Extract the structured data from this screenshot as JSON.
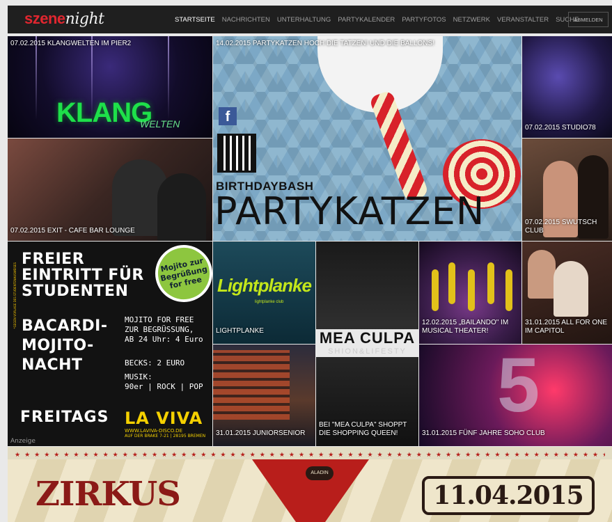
{
  "logo": {
    "part1": "szene",
    "part2": "night"
  },
  "nav": {
    "items": [
      "STARTSEITE",
      "NACHRICHTEN",
      "UNTERHALTUNG",
      "PARTYKALENDER",
      "PARTYFOTOS",
      "NETZWERK",
      "VERANSTALTER",
      "SUCHE"
    ],
    "logout": "ABMELDEN"
  },
  "tiles": {
    "t1": {
      "caption": "07.02.2015 KLANGWELTEN IM PIER2",
      "art": "KLANG",
      "art2": "WELTEN"
    },
    "t2": {
      "caption": "14.02.2015 PARTYKATZEN HOCH DIE TATZEN! UND DIE BALLONS!",
      "facebook": "f",
      "subtitle": "BIRTHDAYBASH",
      "title": "PARTYKATZEN"
    },
    "t3": {
      "caption": "07.02.2015 STUDIO78"
    },
    "t4": {
      "caption": "07.02.2015 EXIT - CAFE BAR LOUNGE"
    },
    "t5": {
      "caption": "07.02.2015 SWUTSCH CLUB"
    },
    "t6": {
      "caption": "LIGHTPLANKE",
      "art": "Lightplanke",
      "sub": "lightplanke club"
    },
    "t7": {
      "caption": "BEI \"MEA CULPA\" SHOPPT DIE SHOPPING QUEEN!",
      "art": "MEA CULPA",
      "art2": "SHION&LIFESTY"
    },
    "t8": {
      "caption": "12.02.2015 „BAILANDO\" IM MUSICAL THEATER!"
    },
    "t9": {
      "caption": "31.01.2015 ALL FOR ONE IM CAPITOL"
    },
    "t10": {
      "caption": "31.01.2015 JUNIORSENIOR"
    },
    "t11": {
      "caption": "31.01.2015 FÜNF JAHRE SOHO CLUB",
      "art": "5"
    }
  },
  "ad": {
    "line1": "FREIER",
    "line2": "EINTRITT FÜR",
    "line3": "STUDENTEN",
    "side": "*GEGEN VORLAGE DES STUDENTENAUSWEISES",
    "circle": "Mojito zur Begrüßung for free",
    "line4": "BACARDI-",
    "line5": "MOJITO-",
    "line6": "NACHT",
    "hand1": "MOJITO FOR FREE",
    "hand2": "ZUR BEGRÜSSUNG,",
    "hand3": "AB 24 Uhr: 4 Euro",
    "hand4": "BECKS: 2 EURO",
    "hand5": "MUSIK:",
    "hand6": "90er | ROCK | POP",
    "friday": "FREITAGS",
    "brand": "LA VIVA",
    "address1": "WWW.LAVIVA-DISCO.DE",
    "address2": "AUF DER BRAKE 7-21 | 28195 BREMEN",
    "label": "Anzeige"
  },
  "banner": {
    "stars": "★★★★★★★★★★★★★★★★★★★★★★★★★★★★★★★★★★★★★★★★★★★★★★★★★★★★★★★★★★★★★★★★",
    "title": "ZIRKUS",
    "badge": "ALADIN",
    "date": "11.04.2015"
  },
  "colors": {
    "accent": "#e0262f",
    "header_bg": "#1f1f1f",
    "page_bg": "#e9e9e9"
  }
}
